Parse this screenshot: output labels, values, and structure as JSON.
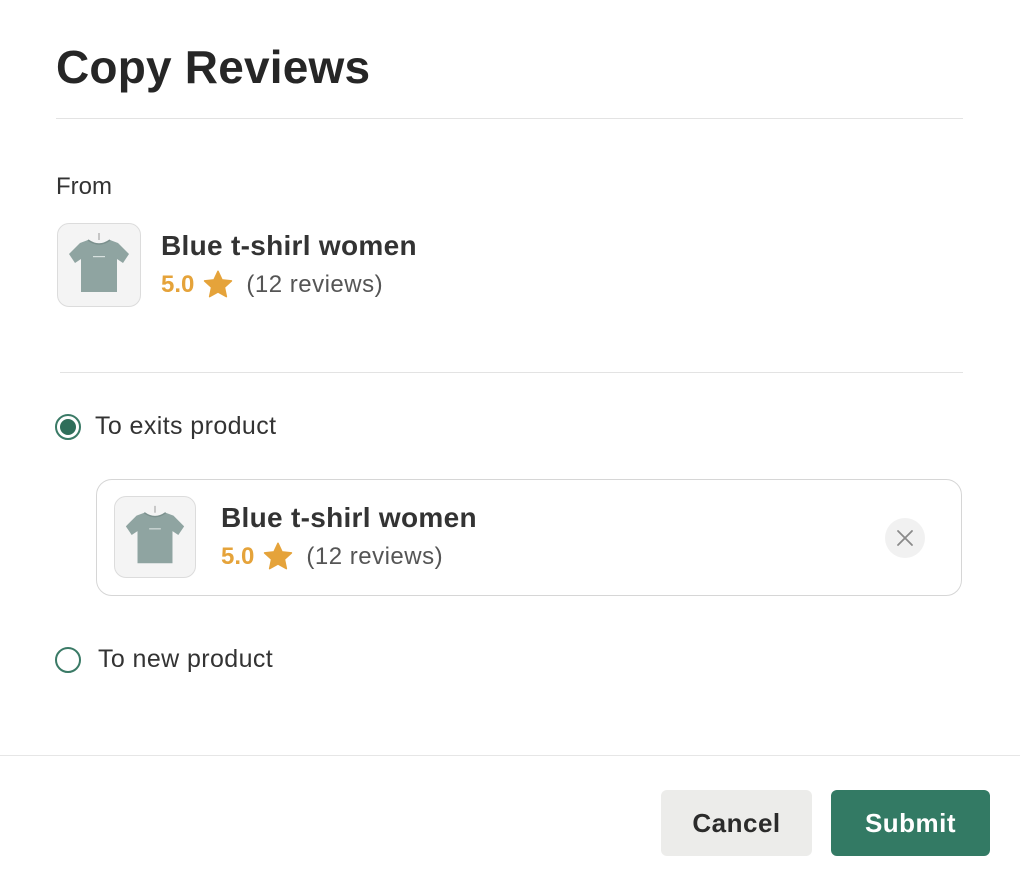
{
  "dialog": {
    "title": "Copy Reviews"
  },
  "from": {
    "label": "From",
    "product": {
      "name": "Blue t-shirl women",
      "rating": "5.0",
      "reviews": "(12 reviews)",
      "icon": "tshirt-thumbnail"
    }
  },
  "options": [
    {
      "label": "To exits product",
      "selected": true
    },
    {
      "label": "To new product",
      "selected": false
    }
  ],
  "selected_product": {
    "name": "Blue t-shirl women",
    "rating": "5.0",
    "reviews": "(12 reviews)",
    "remove_icon": "close-icon"
  },
  "footer": {
    "cancel_label": "Cancel",
    "submit_label": "Submit"
  },
  "colors": {
    "accent": "#337a64",
    "star": "#e5a33a",
    "radio": "#2f6e5a"
  }
}
